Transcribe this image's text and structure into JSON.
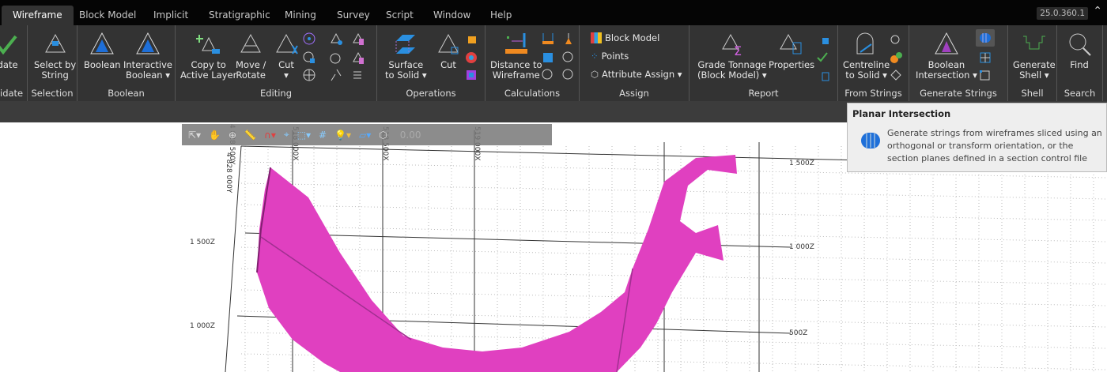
{
  "tabs": [
    "Wireframe",
    "Block Model",
    "Implicit",
    "Stratigraphic",
    "Mining",
    "Survey",
    "Script",
    "Window",
    "Help"
  ],
  "version": "25.0.360.1",
  "groups": {
    "validate": {
      "label": "idate",
      "button": "idate"
    },
    "selection": {
      "label": "Selection",
      "button": "Select by\nString"
    },
    "boolean": {
      "label": "Boolean",
      "b1": "Boolean",
      "b2": "Interactive\nBoolean ▾"
    },
    "editing": {
      "label": "Editing",
      "b1": "Copy to\nActive Layer",
      "b2": "Move /\nRotate",
      "b3": "Cut\n▾"
    },
    "operations": {
      "label": "Operations",
      "b1": "Surface\nto Solid ▾",
      "b2": "Cut"
    },
    "calculations": {
      "label": "Calculations",
      "b1": "Distance to\nWireframe"
    },
    "assign": {
      "label": "Assign",
      "i1": "Block Model",
      "i2": "Points",
      "i3": "Attribute Assign ▾"
    },
    "report": {
      "label": "Report",
      "b1": "Grade Tonnage\n(Block Model) ▾",
      "b2": "Properties"
    },
    "fromstrings": {
      "label": "From Strings",
      "b1": "Centreline\nto Solid ▾"
    },
    "genstrings": {
      "label": "Generate Strings",
      "b1": "Boolean\nIntersection ▾"
    },
    "shell": {
      "label": "Shell",
      "b1": "Generate\nShell ▾"
    },
    "search": {
      "label": "Search",
      "b1": "Find"
    }
  },
  "viewtool": {
    "value": "0.00"
  },
  "axes": {
    "z_right": [
      "1 500Z",
      "1 000Z",
      "500Z"
    ],
    "z_left": [
      "1 500Z",
      "1 000Z"
    ],
    "x": [
      "518 000X",
      "518 500X",
      "519 000X"
    ],
    "y": [
      "4 828 500Y",
      "4 828 000Y"
    ]
  },
  "tooltip": {
    "title": "Planar Intersection",
    "body": "Generate strings from wireframes sliced using an orthogonal or transform orientation, or the section planes defined in a section control file"
  },
  "colors": {
    "accent": "#1e6fd9",
    "solid": "#e040c0"
  }
}
